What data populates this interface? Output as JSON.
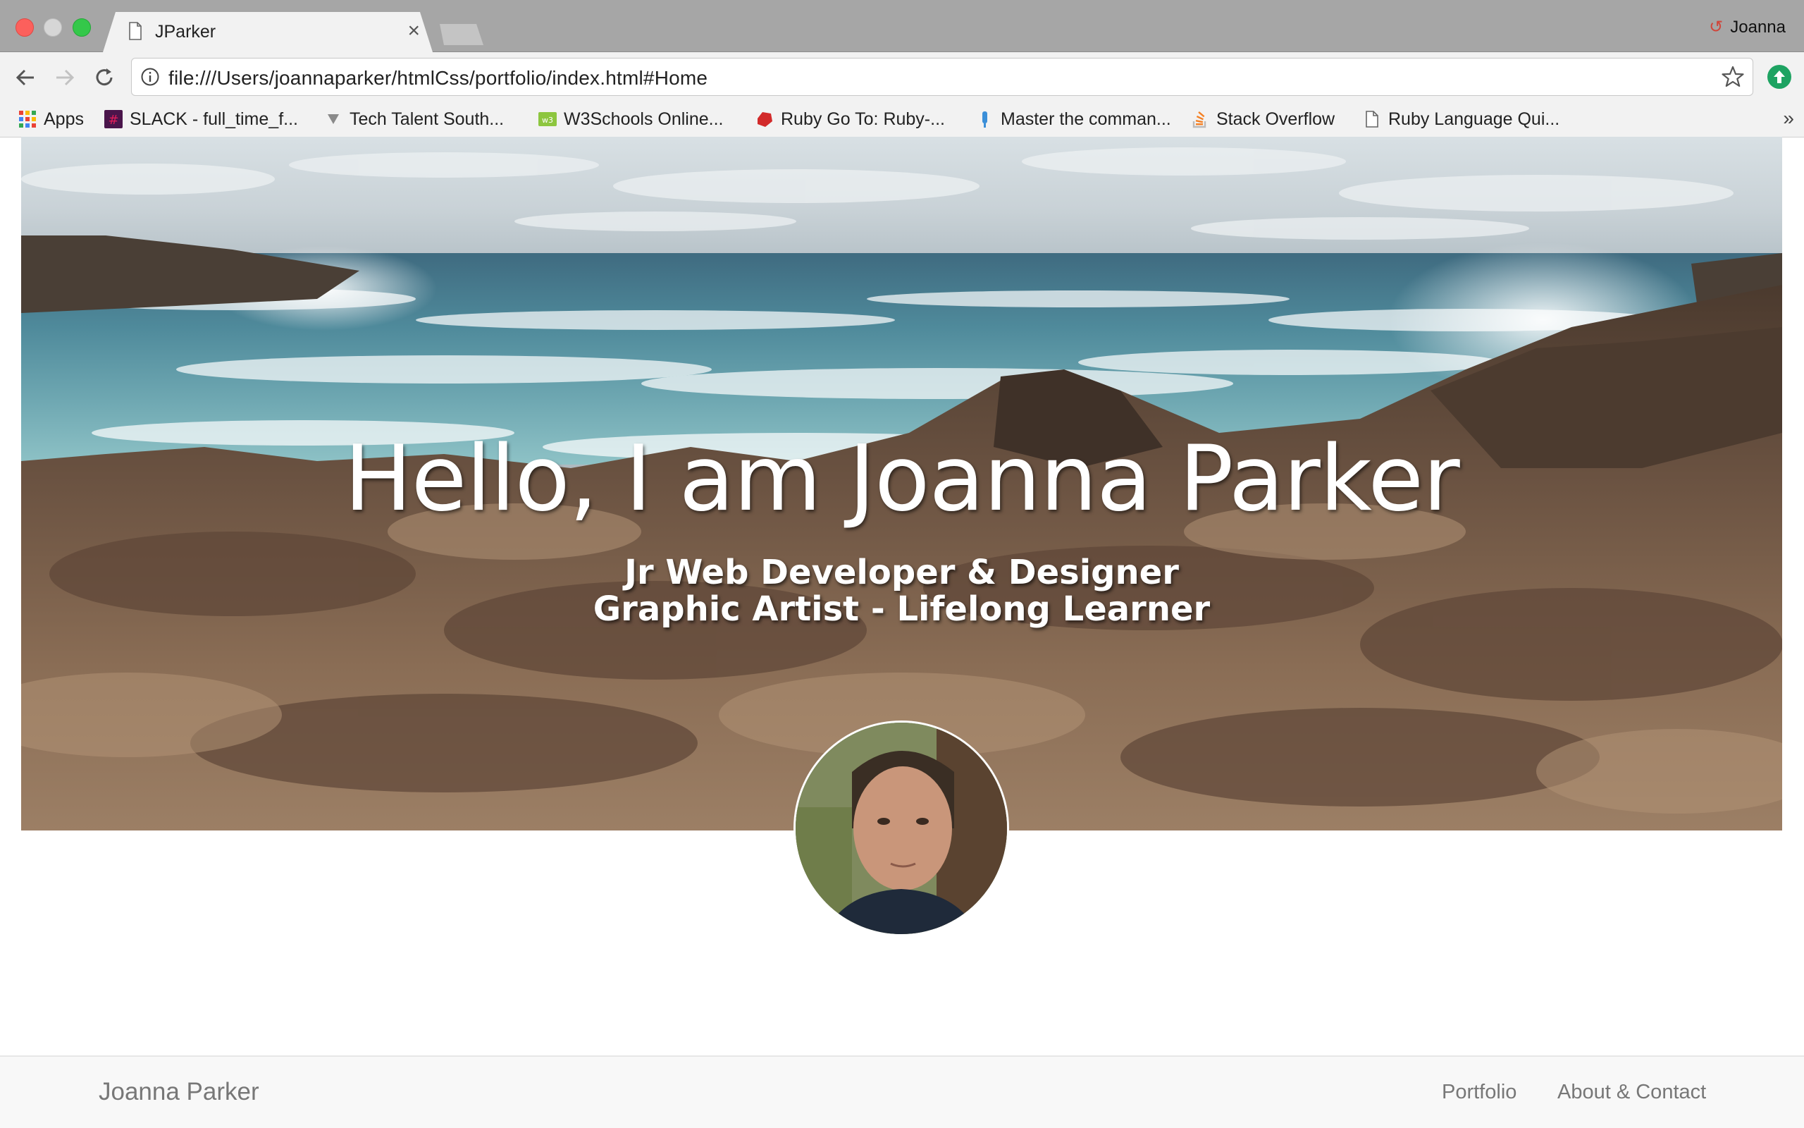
{
  "browser": {
    "tab_title": "JParker",
    "tab_close": "×",
    "profile_name": "Joanna",
    "url": "file:///Users/joannaparker/htmlCss/portfolio/index.html#Home",
    "bookmarks": [
      {
        "label": "Apps",
        "icon": "apps-grid-icon"
      },
      {
        "label": "SLACK - full_time_f...",
        "icon": "slack-icon"
      },
      {
        "label": "Tech Talent South...",
        "icon": "tts-icon"
      },
      {
        "label": "W3Schools Online...",
        "icon": "w3schools-icon"
      },
      {
        "label": "Ruby Go To: Ruby-...",
        "icon": "ruby-icon"
      },
      {
        "label": "Master the comman...",
        "icon": "command-line-icon"
      },
      {
        "label": "Stack Overflow",
        "icon": "stack-overflow-icon"
      },
      {
        "label": "Ruby Language Qui...",
        "icon": "page-icon"
      }
    ],
    "more_bookmarks": "»"
  },
  "hero": {
    "title": "Hello, I am Joanna Parker",
    "subtitle_line1": "Jr Web Developer & Designer",
    "subtitle_line2": "Graphic Artist - Lifelong Learner"
  },
  "footer": {
    "brand": "Joanna Parker",
    "nav": [
      "Portfolio",
      "About & Contact"
    ]
  },
  "colors": {
    "chrome_bg": "#f2f2f2",
    "tabbar_bg": "#a6a6a6",
    "footer_bg": "#f8f8f8",
    "footer_text": "#777777",
    "extension_green": "#1ea362"
  }
}
